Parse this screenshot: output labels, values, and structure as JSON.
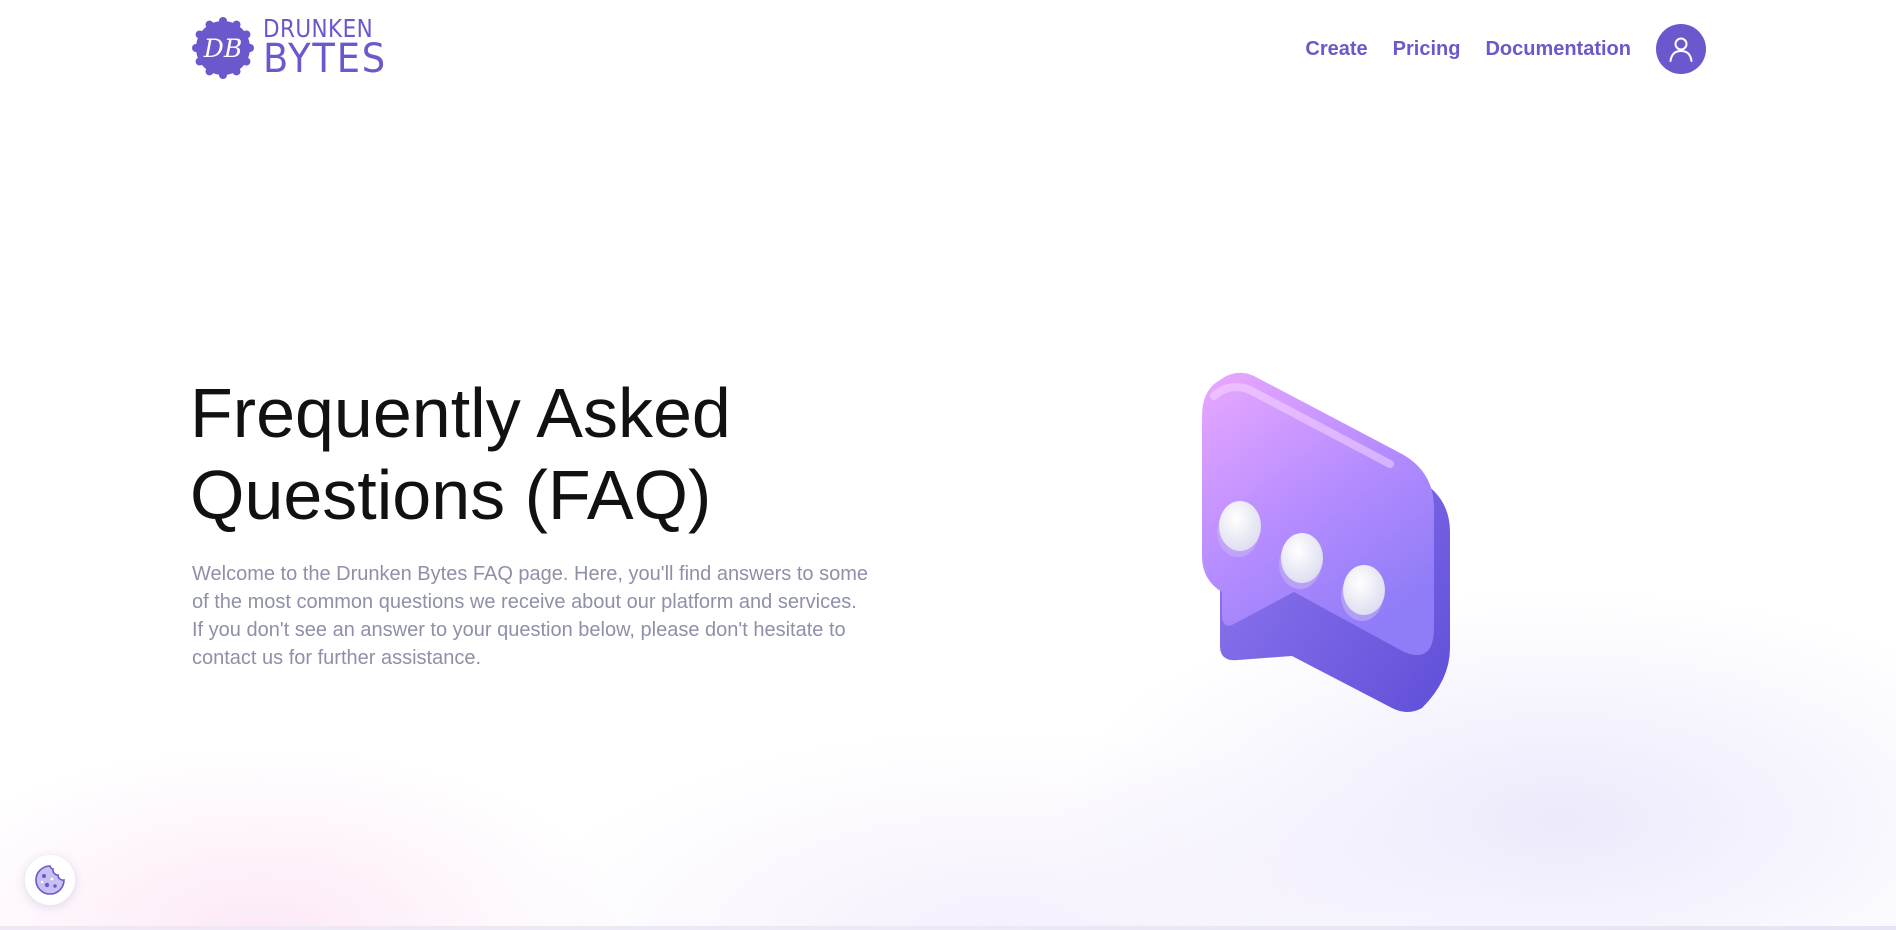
{
  "header": {
    "logo": {
      "monogram": "DB",
      "line1": "DRUNKEN",
      "line2": "BYTES",
      "icon": "db-monogram-badge"
    },
    "nav": [
      {
        "label": "Create"
      },
      {
        "label": "Pricing"
      },
      {
        "label": "Documentation"
      }
    ],
    "account_icon": "user-icon"
  },
  "hero": {
    "title": "Frequently Asked Questions (FAQ)",
    "description": "Welcome to the Drunken Bytes FAQ page. Here, you'll find answers to some of the most common questions we receive about our platform and services. If you don't see an answer to your question below, please don't hesitate to contact us for further assistance.",
    "illustration": "chat-bubble-icon"
  },
  "cookie_settings_icon": "cookie-icon",
  "colors": {
    "brand": "#6b58cc",
    "title": "#111111",
    "description": "#8e90a8",
    "bubble_light": "#e9a6ff",
    "bubble_dark": "#7d6af0"
  }
}
